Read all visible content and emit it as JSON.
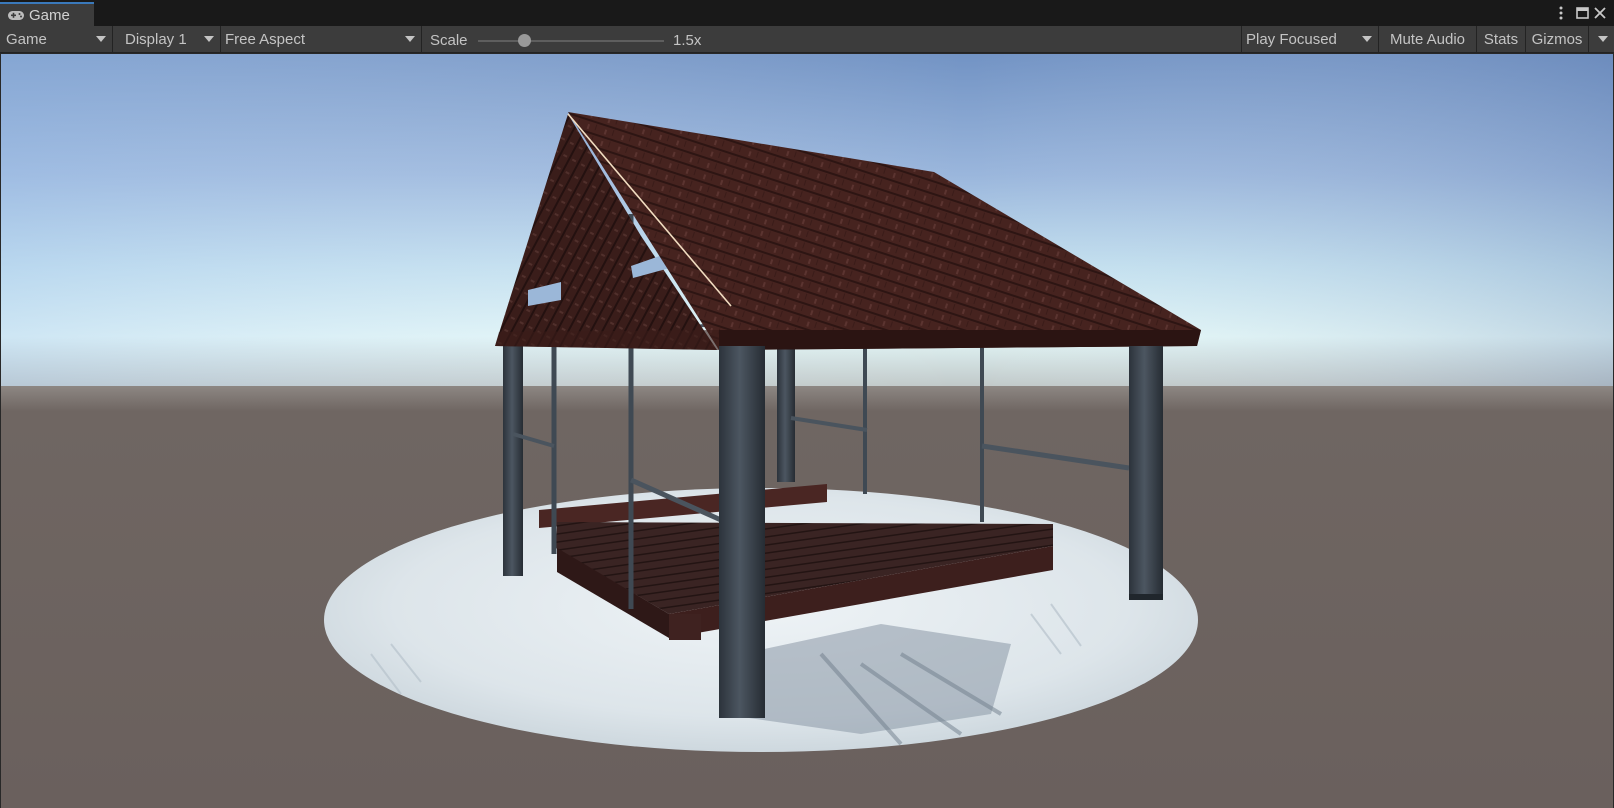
{
  "window": {
    "tab_label": "Game",
    "tab_icon": "gamepad-icon",
    "controls": [
      "kebab-menu-icon",
      "maximize-icon",
      "close-icon"
    ]
  },
  "toolbar": {
    "view_mode": "Game",
    "display": "Display 1",
    "aspect": "Free Aspect",
    "scale_label": "Scale",
    "scale_value": "1.5x",
    "scale_fraction": 0.25,
    "play_mode": "Play Focused",
    "mute_audio": "Mute Audio",
    "stats": "Stats",
    "gizmos": "Gizmos"
  },
  "scene": {
    "description_icon": "game-render-view",
    "colors": {
      "sky_top": "#7394c6",
      "horizon": "#d8eef4",
      "ground": "#6d6461",
      "snow": "#dfe7ec",
      "roof": "#43201d",
      "post": "#3a434d"
    }
  }
}
